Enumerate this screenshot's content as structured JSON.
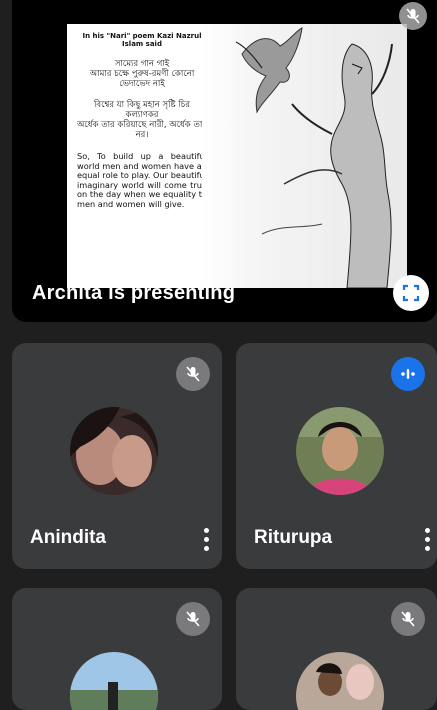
{
  "presentation": {
    "presenter_label": "Archita is presenting",
    "slide": {
      "heading": "In his \"Nari\" poem Kazi Nazrul Islam said",
      "bengali_1": "সাম্যের গান গাই\nআমার চক্ষে পুরুষ-রমণী কোনো ভেদাভেদ নাই",
      "bengali_2": "বিশ্বের যা কিছু মহান সৃষ্টি চির কল্যাণকর\nঅর্ধেক তার করিয়াছে নারী, অর্ধেক তার নর।",
      "english": "So, To build up a beautiful world men and women have an equal role to play. Our beautiful imaginary world will come true on the day when we equality to men and women will give."
    }
  },
  "participants": [
    {
      "name": "Anindita",
      "mic": "muted"
    },
    {
      "name": "Riturupa",
      "mic": "speaking"
    },
    {
      "name": "",
      "mic": "muted"
    },
    {
      "name": "",
      "mic": "muted"
    }
  ],
  "colors": {
    "speaking_blue": "#1a73e8",
    "tile_bg": "#3a3b3d"
  }
}
